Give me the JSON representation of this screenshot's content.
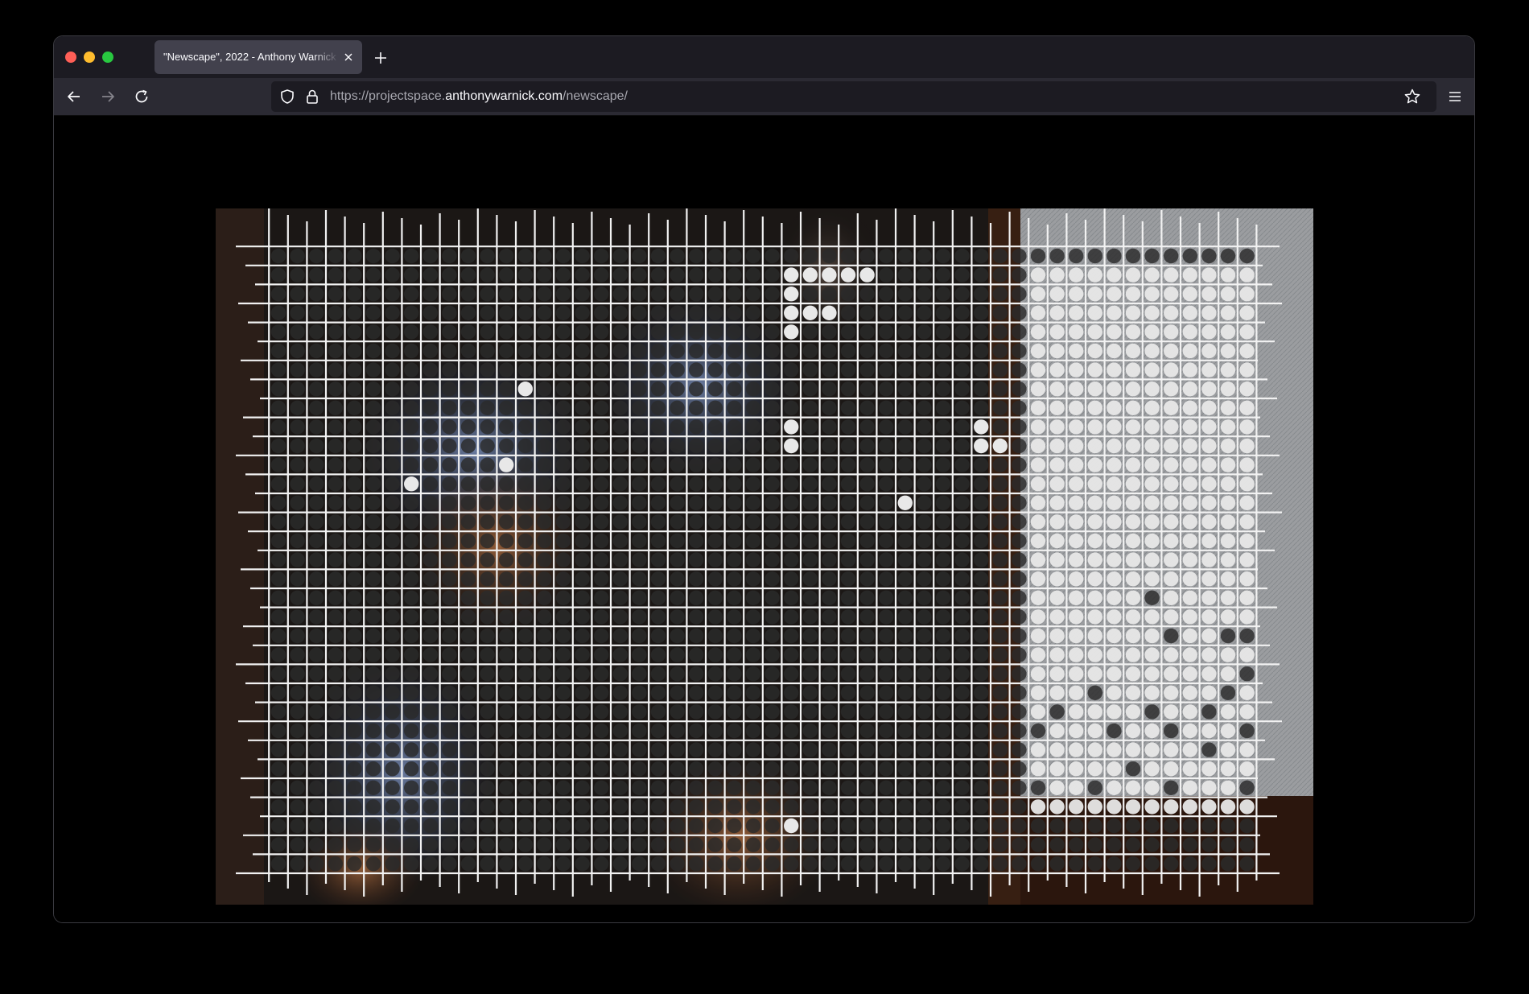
{
  "browser": {
    "tab_title": "\"Newscape\", 2022 - Anthony Warnick",
    "url_prefix": "https://projectspace.",
    "url_domain": "anthonywarnick.com",
    "url_path": "/newscape/",
    "colors": {
      "tabstrip": "#1c1b22",
      "toolbar": "#2b2a33",
      "active_tab": "#42414d",
      "urlbar": "#1c1b22",
      "traffic_close": "#ff5f57",
      "traffic_minimize": "#febc2e",
      "traffic_maximize": "#28c840"
    },
    "icons": [
      "close-icon",
      "plus-icon",
      "back-arrow-icon",
      "forward-arrow-icon",
      "reload-icon",
      "shield-icon",
      "lock-icon",
      "star-icon",
      "hamburger-menu-icon"
    ]
  },
  "artwork": {
    "title": "Newscape",
    "grid_columns": 52,
    "grid_rows": 33,
    "dot_colors": {
      "light": "#e8e8e8",
      "dark": "#2b2b2b",
      "line": "#f2f2f2"
    },
    "white_dots": [
      [
        1,
        27
      ],
      [
        1,
        28
      ],
      [
        1,
        29
      ],
      [
        1,
        30
      ],
      [
        1,
        31
      ],
      [
        2,
        27
      ],
      [
        3,
        27
      ],
      [
        3,
        28
      ],
      [
        3,
        29
      ],
      [
        4,
        27
      ],
      [
        7,
        13
      ],
      [
        9,
        27
      ],
      [
        9,
        37
      ],
      [
        10,
        27
      ],
      [
        10,
        37
      ],
      [
        10,
        38
      ],
      [
        11,
        12
      ],
      [
        12,
        7
      ],
      [
        13,
        33
      ]
    ],
    "light_region": {
      "col_start": 40,
      "col_end": 51,
      "row_start": 1,
      "row_end": 29
    },
    "dark_dots_in_light_region": [
      [
        18,
        46
      ],
      [
        20,
        47
      ],
      [
        20,
        50
      ],
      [
        20,
        51
      ],
      [
        22,
        51
      ],
      [
        23,
        43
      ],
      [
        23,
        50
      ],
      [
        24,
        41
      ],
      [
        24,
        46
      ],
      [
        24,
        49
      ],
      [
        25,
        40
      ],
      [
        25,
        44
      ],
      [
        25,
        47
      ],
      [
        25,
        51
      ],
      [
        26,
        49
      ],
      [
        27,
        45
      ],
      [
        28,
        40
      ],
      [
        28,
        43
      ],
      [
        28,
        47
      ],
      [
        28,
        51
      ]
    ],
    "stray_white_dots": [
      [
        30,
        27
      ]
    ]
  }
}
